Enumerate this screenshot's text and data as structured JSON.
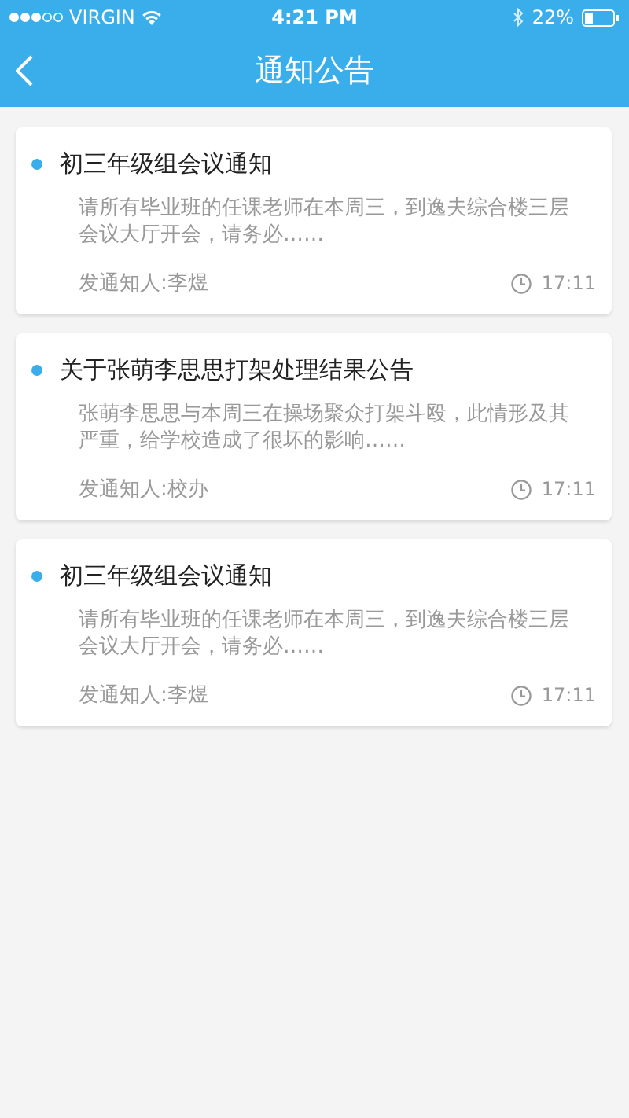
{
  "status_bar": {
    "carrier": "VIRGIN",
    "time": "4:21 PM",
    "battery": "22%"
  },
  "nav": {
    "title": "通知公告"
  },
  "notices": [
    {
      "title": "初三年级组会议通知",
      "unread": true,
      "summary": "请所有毕业班的任课老师在本周三，到逸夫综合楼三层会议大厅开会，请务必……",
      "sender": "发通知人:李煜",
      "time": "17:11"
    },
    {
      "title": "关于张萌李思思打架处理结果公告",
      "unread": true,
      "summary": "张萌李思思与本周三在操场聚众打架斗殴，此情形及其严重，给学校造成了很坏的影响……",
      "sender": "发通知人:校办",
      "time": "17:11"
    },
    {
      "title": "初三年级组会议通知",
      "unread": true,
      "summary": "请所有毕业班的任课老师在本周三，到逸夫综合楼三层会议大厅开会，请务必……",
      "sender": "发通知人:李煜",
      "time": "17:11"
    }
  ]
}
